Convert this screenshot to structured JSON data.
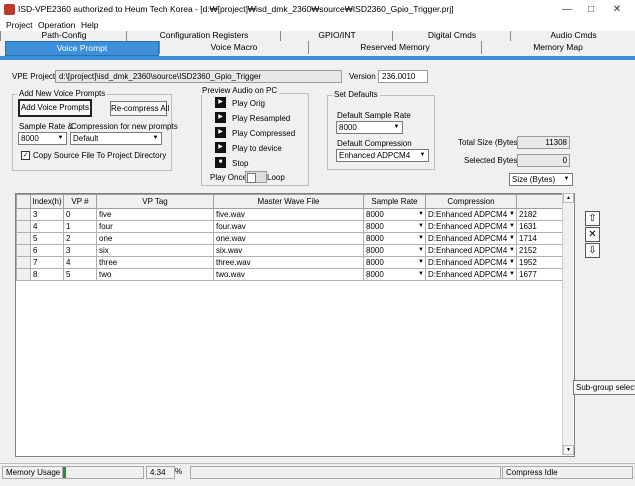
{
  "window": {
    "title": "ISD-VPE2360 authorized to Heum Tech Korea - [d:₩[project]₩isd_dmk_2360₩source₩ISD2360_Gpio_Trigger.prj]",
    "minimize": "—",
    "maximize": "□",
    "close": "✕"
  },
  "menu": [
    "Project",
    "Operation",
    "Help"
  ],
  "tabs_row1": [
    "Path-Config",
    "Configuration Registers",
    "GPIO/INT",
    "Digital Cmds",
    "Audio Cmds"
  ],
  "tabs_row2": [
    "Voice Prompt",
    "Voice Macro",
    "Reserved Memory",
    "Memory Map"
  ],
  "vpe_project": {
    "label": "VPE Project",
    "value": "d:\\[project]\\isd_dmk_2360\\source\\ISD2360_Gpio_Trigger"
  },
  "version": {
    "label": "Version",
    "value": "236.0010"
  },
  "add_prompts": {
    "title": "Add New Voice Prompts",
    "add_button": "Add Voice Prompts",
    "recompress_button": "Re-compress All",
    "sample_rate_label": "Sample Rate &",
    "sample_rate_value": "8000",
    "compression_label": "Compression for new prompts",
    "compression_value": "Default",
    "copy_source_label": "Copy Source File To Project Directory",
    "copy_source_checked": "✓"
  },
  "preview": {
    "title": "Preview Audio on PC",
    "play_orig": "Play Orig",
    "play_resampled": "Play Resampled",
    "play_compressed": "Play Compressed",
    "play_device": "Play to device",
    "stop": "Stop",
    "play_once": "Play Once",
    "loop": "Loop"
  },
  "set_defaults": {
    "title": "Set Defaults",
    "sample_rate_label": "Default Sample Rate",
    "sample_rate_value": "8000",
    "compression_label": "Default Compression",
    "compression_value": "Enhanced ADPCM4"
  },
  "totals": {
    "total_size_label": "Total Size (Bytes)",
    "total_size_value": "11308",
    "selected_label": "Selected Bytes",
    "selected_value": "0",
    "size_unit": "Size (Bytes)"
  },
  "table": {
    "headers": [
      "Index(h)",
      "VP #",
      "VP Tag",
      "Master Wave File",
      "Sample Rate",
      "Compression",
      ""
    ],
    "rows": [
      [
        "3",
        "0",
        "five",
        "five.wav",
        "8000",
        "D:Enhanced ADPCM4",
        "2182"
      ],
      [
        "4",
        "1",
        "four",
        "four.wav",
        "8000",
        "D:Enhanced ADPCM4",
        "1631"
      ],
      [
        "5",
        "2",
        "one",
        "one.wav",
        "8000",
        "D:Enhanced ADPCM4",
        "1714"
      ],
      [
        "6",
        "3",
        "six",
        "six.wav",
        "8000",
        "D:Enhanced ADPCM4",
        "2152"
      ],
      [
        "7",
        "4",
        "three",
        "three.wav",
        "8000",
        "D:Enhanced ADPCM4",
        "1952"
      ],
      [
        "8",
        "5",
        "two",
        "two.wav",
        "8000",
        "D:Enhanced ADPCM4",
        "1677"
      ]
    ]
  },
  "side": {
    "subgroup": "Sub-group selection",
    "up": "⇧",
    "delete": "✕",
    "down": "⇩"
  },
  "status": {
    "memory_label": "Memory Usage",
    "memory_value": "4.34",
    "memory_unit": "%",
    "memory_fraction": 0.0434,
    "compress_status": "Compress Idle"
  },
  "colors": {
    "accent": "#3c8fd8",
    "progress": "#2e8b3a"
  }
}
